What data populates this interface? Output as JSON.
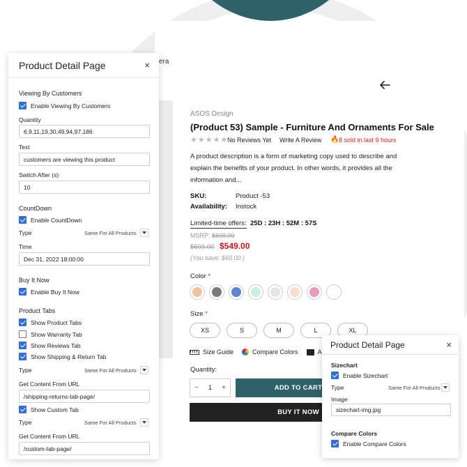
{
  "breadcrumb_fragment": "era",
  "product": {
    "brand": "ASOS Design",
    "title": "(Product 53) Sample - Furniture And Ornaments For Sale",
    "reviews_text": "No Reviews Yet",
    "write_review": "Write A Review",
    "sold_text": "8 sold in last 9 hours",
    "description": "A product description is a form of marketing copy used to describe and explain the benefits of your product. In other words, it provides all the information and...",
    "sku_label": "SKU:",
    "sku_value": "Product -53",
    "availability_label": "Availability:",
    "availability_value": "Instock",
    "limited_offer_label": "Limited-time offers:",
    "countdown": "25D : 23H : 52M : 57S",
    "msrp_label": "MSRP:",
    "msrp_value": "$609.00",
    "old_price": "$609.00",
    "new_price": "$549.00",
    "you_save": "(You save: $60.00 )",
    "color_label": "Color",
    "color_swatches": [
      "#f0c49d",
      "#7a7a7a",
      "#5d83d6",
      "#c9efe1",
      "#e6e6e6",
      "#fcdcd1",
      "#e79bbb",
      "#ffffff"
    ],
    "size_label": "Size",
    "sizes": [
      "XS",
      "S",
      "M",
      "L",
      "XL"
    ],
    "size_guide": "Size Guide",
    "compare_colors": "Compare Colors",
    "ask_fragment": "A",
    "quantity_label": "Quantity:",
    "quantity_value": "1",
    "minus": "−",
    "plus": "+",
    "add_to_cart": "ADD TO CART",
    "buy_now": "BUY IT NOW",
    "required_mark": "*"
  },
  "panel_left": {
    "title": "Product Detail Page",
    "close": "×",
    "viewing_heading": "Viewing By Customers",
    "enable_viewing": "Enable Viewing By Customers",
    "quantity_label": "Quantity",
    "quantity_value": "6,9,11,19,30,49,94,97,186",
    "text_label": "Text",
    "text_value": "customers are viewing this product",
    "switch_label": "Switch After (s)",
    "switch_value": "10",
    "countdown_heading": "CountDown",
    "enable_countdown": "Enable CountDown",
    "type_label": "Type",
    "type_value": "Same For All Products",
    "time_label": "Time",
    "time_value": "Dec 31, 2022 18:00:00",
    "buy_heading": "Buy It Now",
    "enable_buy": "Enable Buy It Now",
    "tabs_heading": "Product Tabs",
    "show_product_tabs": "Show Product Tabs",
    "show_warranty_tab": "Show Warranty Tab",
    "show_reviews_tab": "Show Reviews Tab",
    "show_shipping_tab": "Show Shipping & Return Tab",
    "type2_label": "Type",
    "type2_value": "Same For All Products",
    "get_content_label": "Get Content From URL",
    "shipping_url": "/shipping-returns-tab-page/",
    "show_custom_tab": "Show Custom Tab",
    "type3_label": "Type",
    "type3_value": "Same For All Products",
    "get_content_label2": "Get Content From URL",
    "custom_url": "/custom-tab-page/"
  },
  "panel_right": {
    "title": "Product Detail Page",
    "close": "×",
    "sizechart_heading": "Sizechart",
    "enable_sizechart": "Enable Sizechart",
    "type_label": "Type",
    "type_value": "Same For All Products",
    "image_label": "Image",
    "image_value": "sizechart-img.jpg",
    "compare_heading": "Compare Colors",
    "enable_compare": "Enable Compare Colors"
  }
}
